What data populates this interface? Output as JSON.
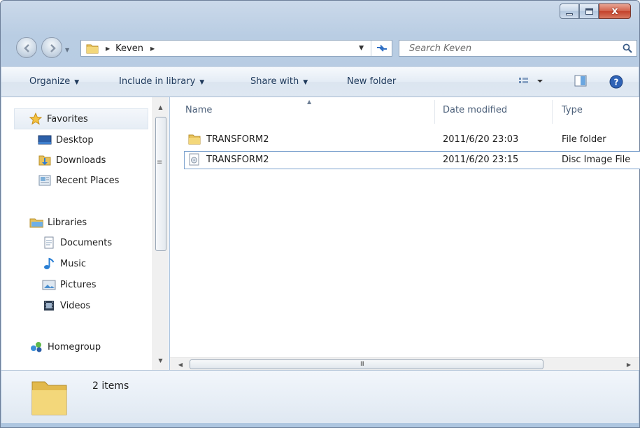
{
  "window": {
    "caption_buttons": [
      "minimize-icon",
      "maximize-icon",
      "close-icon"
    ],
    "close_glyph": "x"
  },
  "address": {
    "path": [
      "Keven"
    ],
    "search_placeholder": "Search Keven"
  },
  "toolbar": {
    "organize": "Organize",
    "include_in_library": "Include in library",
    "share_with": "Share with",
    "new_folder": "New folder"
  },
  "navigation": {
    "favorites": {
      "label": "Favorites",
      "items": [
        "Desktop",
        "Downloads",
        "Recent Places"
      ]
    },
    "libraries": {
      "label": "Libraries",
      "items": [
        "Documents",
        "Music",
        "Pictures",
        "Videos"
      ]
    },
    "homegroup": "Homegroup"
  },
  "file_list": {
    "columns": [
      "Name",
      "Date modified",
      "Type"
    ],
    "rows": [
      {
        "name": "TRANSFORM2",
        "date_modified": "2011/6/20 23:03",
        "type": "File folder",
        "icon": "folder-icon"
      },
      {
        "name": "TRANSFORM2",
        "date_modified": "2011/6/20 23:15",
        "type": "Disc Image File",
        "icon": "disc-image-icon"
      }
    ],
    "sorted_column": "Name"
  },
  "horizontal_scroll_grip": "III",
  "details_pane": {
    "item_count": "2 items"
  },
  "colors": {
    "accent": "#3a78c8",
    "command_text": "#1e395b",
    "close_button": "#c4422b"
  }
}
